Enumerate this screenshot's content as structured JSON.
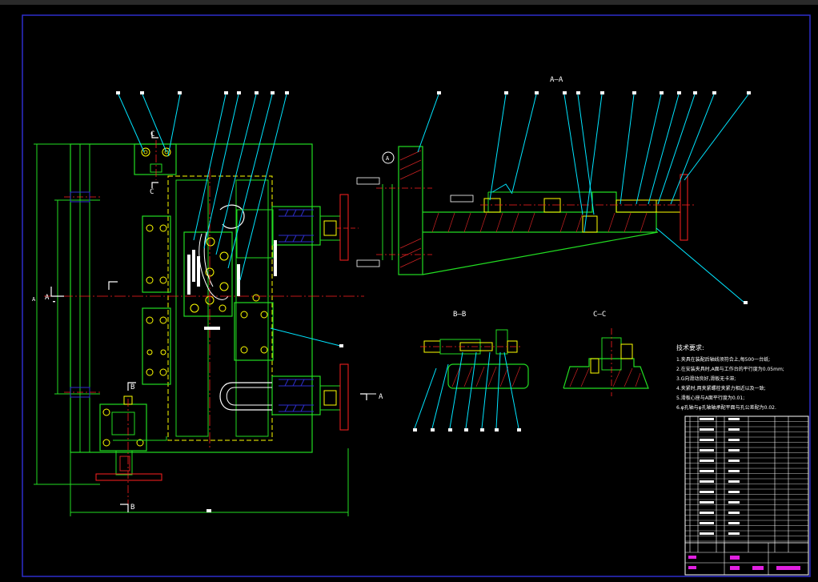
{
  "view_titles": {
    "aa": "A—A",
    "bb": "B—B",
    "cc": "C—C"
  },
  "section_letters": {
    "a": "A",
    "b": "B",
    "c": "C"
  },
  "tech_requirements": {
    "title": "技术要求:",
    "items": [
      "1.夹具在装配后轴线须符合上,每500一台纸;",
      "2.在安装夹具时,A面与工作台的平行度为0.05mm;",
      "3.G向滑动良好,滑板无卡滞;",
      "4.夹紧时,两夹紧螺栓夹紧力相近以及一致;",
      "5.滑板心座与A面平行度为0.01;",
      "6.φ孔轴与φ孔轴轴承配平面与孔公差配为0.02."
    ]
  },
  "colors": {
    "background": "#000000",
    "frame": "#2e2ecc",
    "outline": "#22dd22",
    "leader": "#00e5ff",
    "centerline": "#ff2020",
    "hatch": "#cc2222",
    "yellow": "#ffff00",
    "magenta": "#e020e0",
    "white": "#ffffff"
  }
}
